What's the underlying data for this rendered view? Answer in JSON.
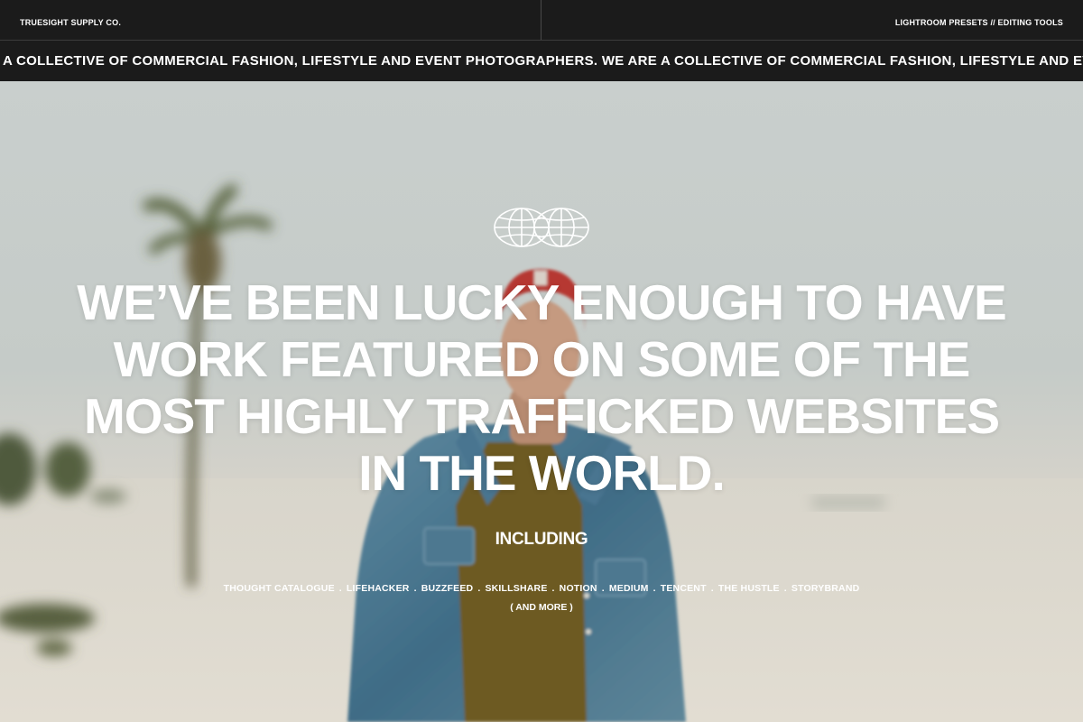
{
  "header": {
    "brand": "TRUESIGHT SUPPLY CO.",
    "links": "LIGHTROOM PRESETS // EDITING TOOLS"
  },
  "marquee": {
    "text": "A COLLECTIVE OF COMMERCIAL FASHION, LIFESTYLE AND EVENT PHOTOGRAPHERS. WE ARE A COLLECTIVE OF COMMERCIAL FASHION, LIFESTYLE AND EVENT PHOTOGRAPHERS."
  },
  "hero": {
    "logo_icon": "double-globe-icon",
    "headline_lines": [
      "WE’VE BEEN LUCKY ENOUGH TO HAVE",
      "WORK FEATURED ON SOME OF THE",
      "MOST HIGHLY TRAFFICKED WEBSITES",
      "IN THE WORLD."
    ],
    "including": "INCLUDING",
    "publications": [
      "THOUGHT CATALOGUE",
      "LIFEHACKER",
      "BUZZFEED",
      "SKILLSHARE",
      "NOTION",
      "MEDIUM",
      "TENCENT",
      "THE HUSTLE",
      "STORYBRAND"
    ],
    "separator": ".",
    "and_more": "( AND MORE )"
  },
  "colors": {
    "bar_background": "#1b1b1b",
    "text_light": "#ffffff"
  }
}
